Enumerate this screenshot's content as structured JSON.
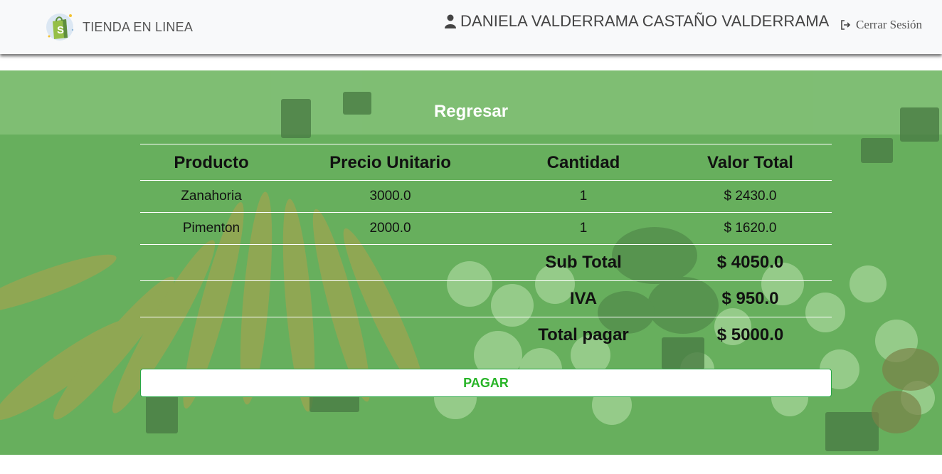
{
  "navbar": {
    "brand": "TIENDA EN LINEA",
    "user_name": "DANIELA VALDERRAMA CASTAÑO VALDERRAMA",
    "logout_label": "Cerrar Sesión"
  },
  "main": {
    "back_label": "Regresar",
    "table": {
      "headers": [
        "Producto",
        "Precio Unitario",
        "Cantidad",
        "Valor Total"
      ],
      "rows": [
        {
          "producto": "Zanahoria",
          "precio": "3000.0",
          "cantidad": "1",
          "total": "$ 2430.0"
        },
        {
          "producto": "Pimenton",
          "precio": "2000.0",
          "cantidad": "1",
          "total": "$ 1620.0"
        }
      ],
      "summary": {
        "subtotal_label": "Sub Total",
        "subtotal_value": "$ 4050.0",
        "iva_label": "IVA",
        "iva_value": "$ 950.0",
        "total_label": "Total pagar",
        "total_value": "$ 5000.0"
      }
    },
    "pay_label": "PAGAR"
  },
  "colors": {
    "accent": "#28a745",
    "overlay_green": "#6ebe64",
    "navbar_bg": "#f8f9fa"
  },
  "icons": [
    "shopify-bag-icon",
    "user-icon",
    "sign-out-icon"
  ]
}
